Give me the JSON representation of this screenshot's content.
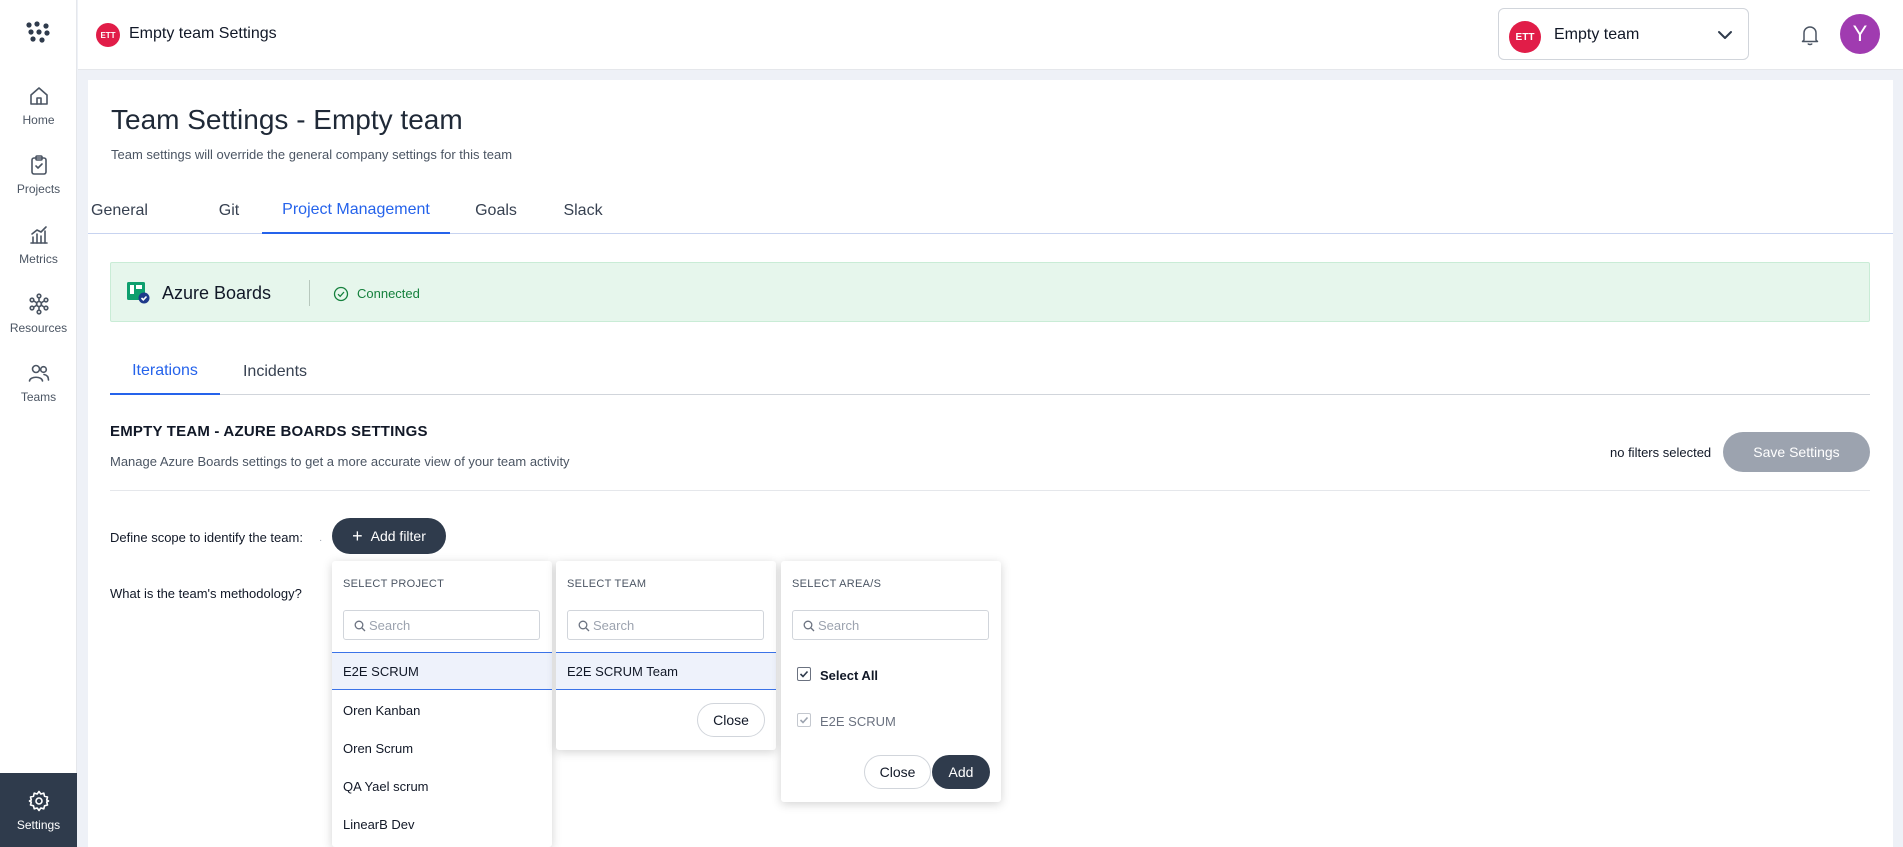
{
  "rail": {
    "items": [
      {
        "label": "Home",
        "icon": "home-icon"
      },
      {
        "label": "Projects",
        "icon": "clipboard-icon"
      },
      {
        "label": "Metrics",
        "icon": "bar-chart-icon"
      },
      {
        "label": "Resources",
        "icon": "network-icon"
      },
      {
        "label": "Teams",
        "icon": "people-icon"
      }
    ],
    "settings_label": "Settings"
  },
  "topbar": {
    "badge": "ETT",
    "title": "Empty team Settings",
    "team_select": {
      "badge": "ETT",
      "label": "Empty team"
    },
    "avatar_initial": "Y"
  },
  "page": {
    "title": "Team Settings - Empty team",
    "subtitle": "Team settings will override the general company settings for this team"
  },
  "tabs": [
    "General",
    "Git",
    "Project Management",
    "Goals",
    "Slack"
  ],
  "active_tab": "Project Management",
  "banner": {
    "name": "Azure Boards",
    "status": "Connected"
  },
  "subtabs": [
    "Iterations",
    "Incidents"
  ],
  "active_subtab": "Iterations",
  "section": {
    "title": "EMPTY TEAM - AZURE BOARDS SETTINGS",
    "subtitle": "Manage Azure Boards settings to get a more accurate view of your team activity",
    "filters_status": "no filters selected",
    "save_label": "Save Settings"
  },
  "form": {
    "scope_label": "Define scope to identify the team:",
    "dot": "·",
    "add_filter_label": "Add filter",
    "methodology_label": "What is the team's methodology?"
  },
  "project_panel": {
    "title": "SELECT PROJECT",
    "search_placeholder": "Search",
    "options": [
      "E2E SCRUM",
      "Oren Kanban",
      "Oren Scrum",
      "QA Yael scrum",
      "LinearB Dev"
    ],
    "selected": "E2E SCRUM"
  },
  "team_panel": {
    "title": "SELECT TEAM",
    "search_placeholder": "Search",
    "options": [
      "E2E SCRUM Team"
    ],
    "close_label": "Close"
  },
  "area_panel": {
    "title": "SELECT AREA/S",
    "search_placeholder": "Search",
    "select_all_label": "Select All",
    "areas": [
      "E2E SCRUM"
    ],
    "close_label": "Close",
    "add_label": "Add"
  },
  "colors": {
    "accent": "#2563eb",
    "dark": "#2f3b4c",
    "connected": "#15803d",
    "badge": "#e11d48",
    "avatar": "#a03bb0"
  }
}
